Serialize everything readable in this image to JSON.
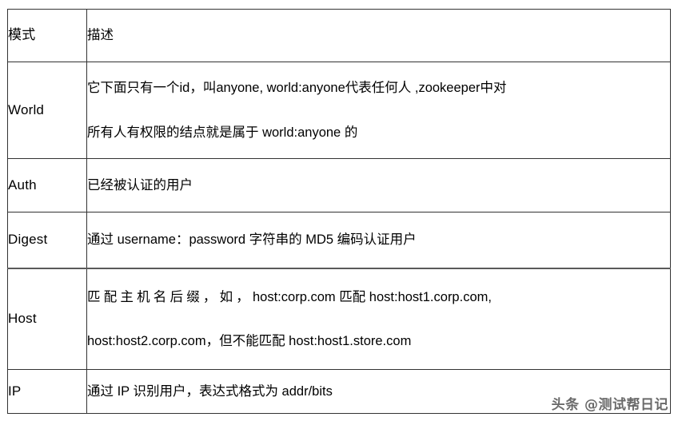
{
  "table": {
    "headers": {
      "mode": "模式",
      "description": "描述"
    },
    "rows": [
      {
        "mode": "World",
        "lines": [
          "它下面只有一个id，叫anyone, world:anyone代表任何人 ,zookeeper中对",
          "所有人有权限的结点就是属于 world:anyone 的"
        ]
      },
      {
        "mode": "Auth",
        "lines": [
          "已经被认证的用户"
        ]
      },
      {
        "mode": "Digest",
        "lines": [
          "通过 username：password 字符串的 MD5 编码认证用户"
        ]
      },
      {
        "mode": "Host",
        "lines": [
          "匹配主机名后缀，如，",
          "host:corp.com  匹配  host:host1.corp.com,",
          "host:host2.corp.com，但不能匹配 host:host1.store.com"
        ]
      },
      {
        "mode": "IP",
        "lines": [
          "通过 IP 识别用户，表达式格式为 addr/bits"
        ]
      }
    ]
  },
  "watermark": {
    "text": "头条 @测试帮日记"
  }
}
